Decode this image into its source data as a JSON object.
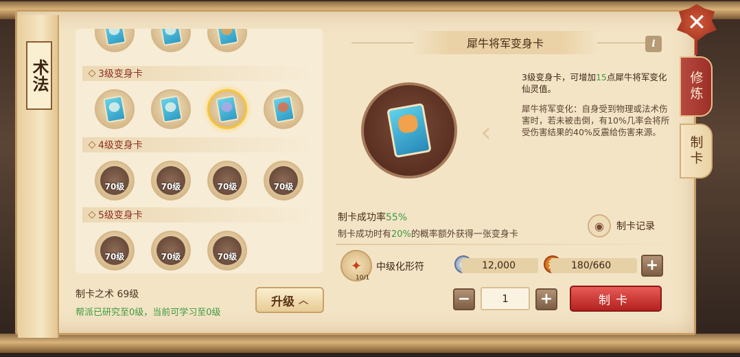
{
  "panel_title": "术法",
  "tiers": [
    {
      "label": "",
      "cards": [
        "blue",
        "blue",
        "orange"
      ]
    },
    {
      "label": "3级变身卡",
      "cards": [
        "blue",
        "blue",
        "purple",
        "red"
      ]
    },
    {
      "label": "4级变身卡",
      "locked": [
        "70级",
        "70级",
        "70级",
        "70级"
      ]
    },
    {
      "label": "5级变身卡",
      "locked": [
        "70级",
        "70级",
        "70级"
      ]
    }
  ],
  "skill": {
    "name": "制卡之术 69级",
    "desc": "帮派已研究至0级，当前可学习至0级"
  },
  "upgrade_label": "升级",
  "card_title": "犀牛将军变身卡",
  "info_label": "i",
  "description": {
    "line1_prefix": "3级变身卡，可增加",
    "line1_value": "15",
    "line1_suffix": "点犀牛将军变化仙灵值。",
    "effect": "犀牛将军变化：自身受到物理或法术伤害时，若未被击倒，有10%几率会将所受伤害结果的40%反震给伤害来源。"
  },
  "rate": {
    "label": "制卡成功率",
    "value": "55%",
    "sub_prefix": "制卡成功时有",
    "sub_value": "20%",
    "sub_suffix": "的概率额外获得一张变身卡"
  },
  "record_label": "制卡记录",
  "material": {
    "name": "中级化形符",
    "count": "10/1"
  },
  "silver": "12,000",
  "vigor": "180/660",
  "quantity": "1",
  "make_label": "制卡",
  "tabs": {
    "cultivate": "修炼",
    "make": "制卡"
  },
  "close_label": "✕",
  "colors": {
    "accent_red": "#b3221f",
    "highlight_green": "#3c9a3c",
    "selected_gold": "#f4c43a"
  }
}
